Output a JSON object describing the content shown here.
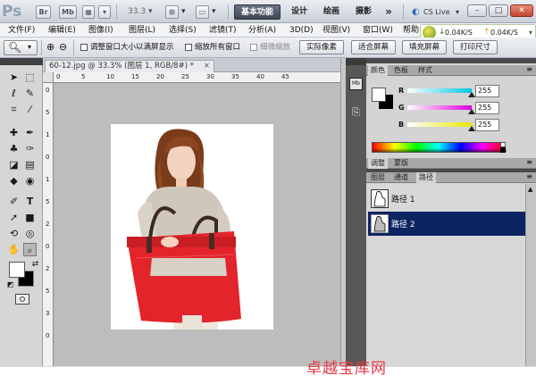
{
  "app": {
    "logo_text": "Ps",
    "bridge_label": "Br",
    "minibridge_label": "Mb",
    "zoom_value": "33.3",
    "workspaces": [
      "基本功能",
      "设计",
      "绘画",
      "摄影"
    ],
    "more_label": "»",
    "cslive_label": "CS Live",
    "window_buttons": {
      "minimize": "–",
      "restore": "□",
      "close": "✕"
    }
  },
  "network": {
    "down_speed": "0.04K/S",
    "up_speed": "0.04K/S"
  },
  "menu": [
    "文件(F)",
    "编辑(E)",
    "图像(I)",
    "图层(L)",
    "选择(S)",
    "滤镜(T)",
    "分析(A)",
    "3D(D)",
    "视图(V)",
    "窗口(W)",
    "帮助"
  ],
  "options": {
    "resize_windows_label": "调整窗口大小以满屏显示",
    "zoom_all_label": "缩放所有窗口",
    "scrubby_zoom_label": "细微缩放",
    "buttons": [
      "实际像素",
      "适合屏幕",
      "填充屏幕",
      "打印尺寸"
    ]
  },
  "document": {
    "tab_title": "60-12.jpg @ 33.3% (图层 1, RGB/8#) *",
    "tab_close": "×",
    "ruler_top": [
      "0",
      "5",
      "10",
      "15",
      "20",
      "25",
      "30",
      "35",
      "40",
      "45"
    ],
    "ruler_left": [
      "0",
      "5",
      "1",
      "0",
      "1",
      "5",
      "2",
      "0",
      "2",
      "5",
      "3",
      "0"
    ]
  },
  "panels": {
    "color_tabs": [
      "颜色",
      "色板",
      "样式"
    ],
    "sliders": [
      {
        "label": "R",
        "value": "255",
        "color": "#00c6e4"
      },
      {
        "label": "G",
        "value": "255",
        "color": "#e200e2"
      },
      {
        "label": "B",
        "value": "255",
        "color": "#e8e800"
      }
    ],
    "adjust_tabs": [
      "调整",
      "蒙版"
    ],
    "layer_tabs": [
      "图层",
      "通道",
      "路径"
    ],
    "paths": [
      {
        "name": "路径 1",
        "selected": false
      },
      {
        "name": "路径 2",
        "selected": true
      }
    ]
  },
  "watermark": "卓越宝库网",
  "colors": {
    "selection": "#0d2462",
    "bag_red": "#e3242b",
    "watermark_red": "#e63a46"
  }
}
